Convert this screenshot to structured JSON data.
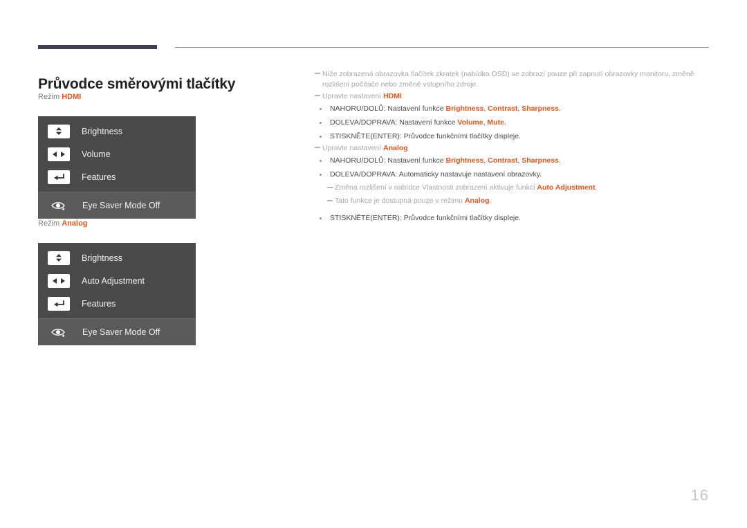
{
  "document": {
    "title": "Průvodce směrovými tlačítky",
    "page_number": "16"
  },
  "colors": {
    "accent": "#e2571e",
    "rule_thick": "#453c52",
    "rule_thin": "#8d8d8d",
    "osd_background": "#4a4a4a",
    "osd_row_highlight": "#5a5a5a",
    "body_text": "#4a4a4a",
    "note_text": "#a7a7a7",
    "page_number": "#c6c6c6"
  },
  "sections": [
    {
      "mode_prefix": "Režim ",
      "mode_value": "HDMI",
      "osd_rows": [
        {
          "icon": "updown-arrow-key-icon",
          "label": "Brightness"
        },
        {
          "icon": "leftright-arrow-key-icon",
          "label": "Volume"
        },
        {
          "icon": "enter-key-icon",
          "label": "Features"
        },
        {
          "icon": "eye-saver-icon",
          "label": "Eye Saver Mode Off"
        }
      ]
    },
    {
      "mode_prefix": "Režim ",
      "mode_value": "Analog",
      "osd_rows": [
        {
          "icon": "updown-arrow-key-icon",
          "label": "Brightness"
        },
        {
          "icon": "leftright-arrow-key-icon",
          "label": "Auto Adjustment"
        },
        {
          "icon": "enter-key-icon",
          "label": "Features"
        },
        {
          "icon": "eye-saver-icon",
          "label": "Eye Saver Mode Off"
        }
      ]
    }
  ],
  "body": {
    "note_intro_line1": "Níže zobrazená obrazovka tlačítek zkratek (nabídka OSD) se zobrazí pouze při zapnutí obrazovky monitoru, změně rozlišení",
    "note_intro_line2": "počítače nebo změně vstupního zdroje.",
    "note_hdmi_prefix": "Upravte nastavení ",
    "note_hdmi_value": "HDMI",
    "hdmi_bullets": [
      {
        "prefix": "NAHORU/DOLŮ: Nastavení funkce ",
        "hl1": "Brightness",
        "sep1": ", ",
        "hl2": "Contrast",
        "sep2": ", ",
        "hl3": "Sharpness",
        "suffix": "."
      },
      {
        "prefix": "DOLEVA/DOPRAVA: Nastavení funkce ",
        "hl1": "Volume",
        "sep1": ", ",
        "hl2": "Mute",
        "sep2": "",
        "hl3": "",
        "suffix": "."
      },
      {
        "prefix": "STISKNĚTE(ENTER): Průvodce funkčními tlačítky displeje.",
        "hl1": "",
        "sep1": "",
        "hl2": "",
        "sep2": "",
        "hl3": "",
        "suffix": ""
      }
    ],
    "note_analog_prefix": "Upravte nastavení ",
    "note_analog_value": "Analog",
    "analog_bullet_1": {
      "prefix": "NAHORU/DOLŮ: Nastavení funkce ",
      "hl1": "Brightness",
      "sep1": ", ",
      "hl2": "Contrast",
      "sep2": ", ",
      "hl3": "Sharpness",
      "suffix": "."
    },
    "analog_bullet_2": {
      "text": "DOLEVA/DOPRAVA: Automaticky nastavuje nastavení obrazovky."
    },
    "analog_subnote_1": {
      "prefix": "Změna rozlišení v nabídce Vlastnosti zobrazení aktivuje funkci ",
      "hl": "Auto Adjustment",
      "suffix": "."
    },
    "analog_subnote_2": {
      "prefix": "Tato funkce je dostupná pouze v režimu ",
      "hl": "Analog",
      "suffix": "."
    },
    "analog_bullet_3": {
      "text": "STISKNĚTE(ENTER): Průvodce funkčními tlačítky displeje."
    }
  }
}
